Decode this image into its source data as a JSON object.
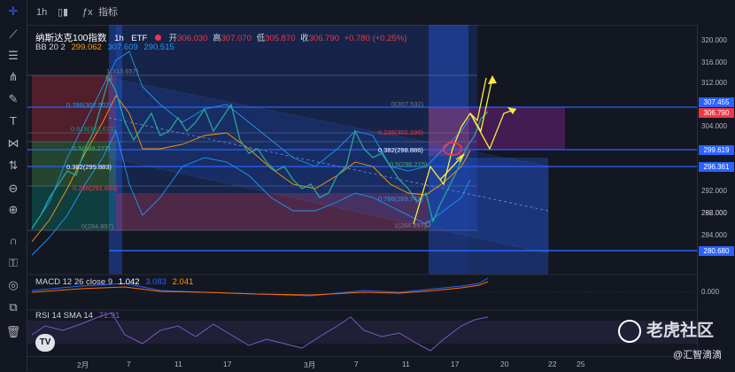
{
  "chart_title": "纳斯达克100指数",
  "interval": "1h",
  "symbol_type": "ETF",
  "toolbar": {
    "indicators_label": "指标",
    "interval_label": "1h"
  },
  "ohlc": {
    "open_label": "开",
    "open": "306.030",
    "high_label": "高",
    "high": "307.070",
    "low_label": "低",
    "low": "305.870",
    "close_label": "收",
    "close": "306.790",
    "change": "+0.780 (+0.25%)"
  },
  "bb": {
    "label": "BB 20 2",
    "basis": "299.062",
    "upper": "307.609",
    "lower": "290.515"
  },
  "macd": {
    "label": "MACD 12 26 close 9",
    "v1": "1.042",
    "v2": "3.083",
    "v3": "2.041",
    "axis_value": "0.000"
  },
  "rsi": {
    "label": "RSI 14 SMA 14",
    "value": "71.91"
  },
  "price_axis": [
    "320.000",
    "316.000",
    "312.000",
    "304.000",
    "300.000",
    "292.000",
    "288.000",
    "284.000"
  ],
  "price_tags": [
    {
      "value": "307.455",
      "color": "#2962ff"
    },
    {
      "value": "306.790",
      "color": "#f23645"
    },
    {
      "value": "299.619",
      "color": "#2962ff"
    },
    {
      "value": "296.361",
      "color": "#2962ff"
    },
    {
      "value": "280.680",
      "color": "#2962ff"
    }
  ],
  "time_axis": [
    "2月",
    "7",
    "11",
    "17",
    "3月",
    "7",
    "11",
    "17",
    "20",
    "22",
    "25"
  ],
  "fib_left": [
    {
      "text": "1(313.657)"
    },
    {
      "text": "0.786(307.502)"
    },
    {
      "text": "0.618(302.671)"
    },
    {
      "text": "0.5(299.277)"
    },
    {
      "text": "0.382(295.883)"
    },
    {
      "text": "0.236(291.684)"
    },
    {
      "text": "0(284.897)"
    }
  ],
  "fib_right": [
    {
      "text": "0(307.532)"
    },
    {
      "text": "0.236(302.190)"
    },
    {
      "text": "0.382(298.886)"
    },
    {
      "text": "0.5(296.215)"
    },
    {
      "text": "0.786(289.741)"
    },
    {
      "text": "1(284.897)"
    }
  ],
  "watermark": "老虎社区",
  "watermark_user": "@汇智滴滴",
  "tv_logo": "TV"
}
